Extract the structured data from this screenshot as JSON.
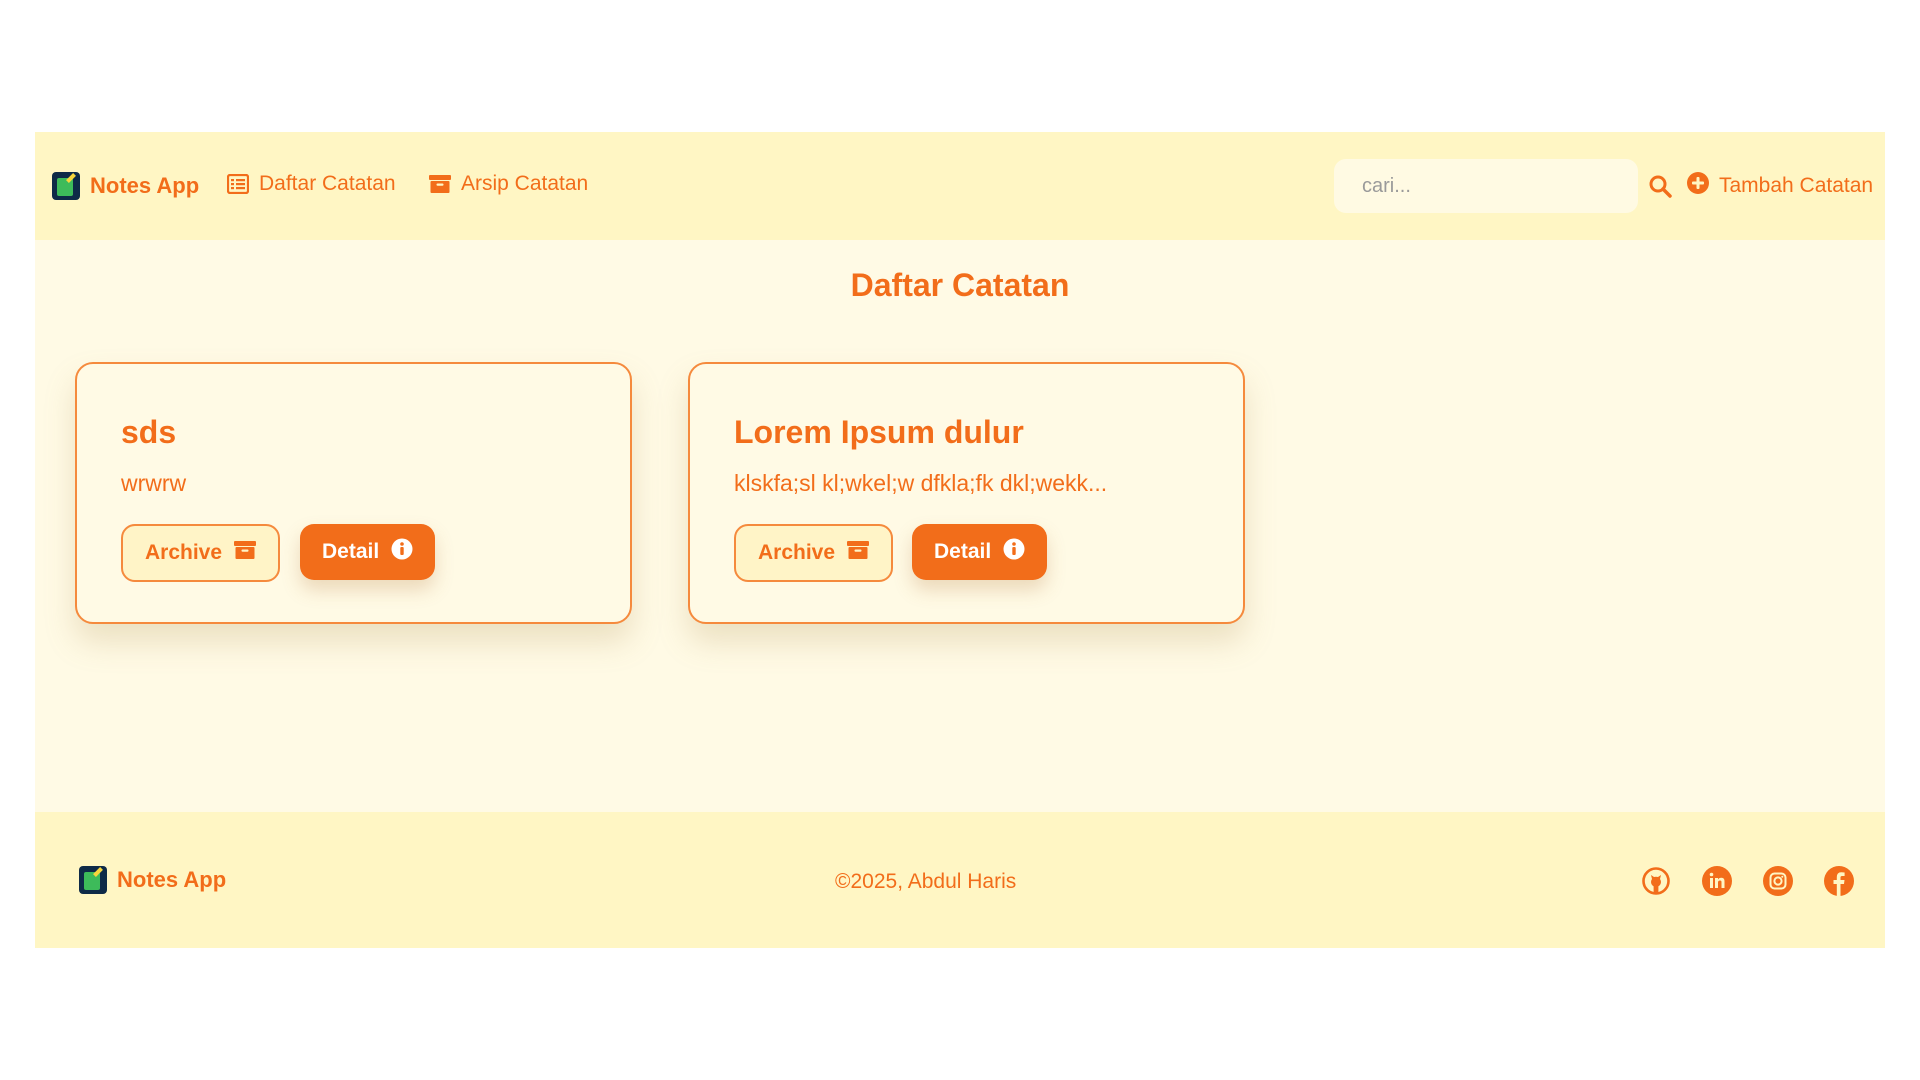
{
  "brand": {
    "name": "Notes App"
  },
  "nav": {
    "links": [
      {
        "label": "Daftar Catatan",
        "icon": "list-icon"
      },
      {
        "label": "Arsip Catatan",
        "icon": "archive-box-icon"
      }
    ],
    "search": {
      "placeholder": "cari...",
      "value": ""
    },
    "add_label": "Tambah Catatan"
  },
  "main": {
    "title": "Daftar Catatan",
    "notes": [
      {
        "title": "sds",
        "body": "wrwrw",
        "archive_label": "Archive",
        "detail_label": "Detail"
      },
      {
        "title": "Lorem Ipsum dulur",
        "body": "klskfa;sl kl;wkel;w dfkla;fk dkl;wekk...",
        "archive_label": "Archive",
        "detail_label": "Detail"
      }
    ]
  },
  "footer": {
    "brand": "Notes App",
    "copyright": "©2025, Abdul Haris",
    "social": [
      "github-icon",
      "linkedin-icon",
      "instagram-icon",
      "facebook-icon"
    ]
  },
  "colors": {
    "accent": "#f26d1a",
    "navbar_bg": "#fff6c4",
    "page_bg": "#fffae5"
  }
}
